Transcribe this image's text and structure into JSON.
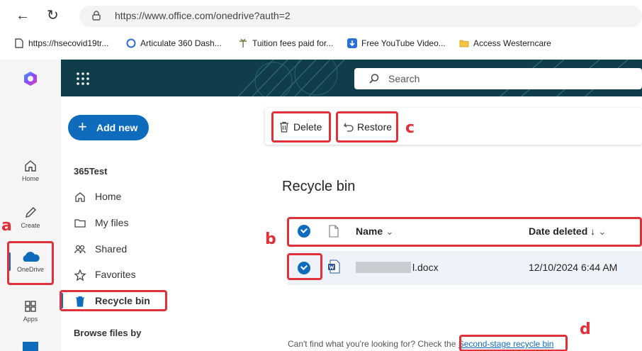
{
  "browser": {
    "url": "https://www.office.com/onedrive?auth=2",
    "bookmarks": [
      "https://hsecovid19tr...",
      "Articulate 360 Dash...",
      "Tuition fees paid for...",
      "Free YouTube Video...",
      "Access Westerncare"
    ]
  },
  "rail": {
    "home": "Home",
    "create": "Create",
    "onedrive": "OneDrive",
    "apps": "Apps"
  },
  "header": {
    "search_placeholder": "Search"
  },
  "leftnav": {
    "add_new": "Add new",
    "account": "365Test",
    "items": [
      "Home",
      "My files",
      "Shared",
      "Favorites",
      "Recycle bin"
    ],
    "browse_title": "Browse files by"
  },
  "commands": {
    "delete": "Delete",
    "restore": "Restore"
  },
  "main": {
    "title": "Recycle bin",
    "col_name": "Name",
    "col_date": "Date deleted",
    "rows": [
      {
        "name_suffix": "l.docx",
        "date": "12/10/2024 6:44 AM"
      }
    ],
    "footer_text": "Can't find what you're looking for? Check the",
    "footer_link": "Second-stage recycle bin"
  },
  "annotations": {
    "a": "a",
    "b": "b",
    "c": "c",
    "d": "d"
  },
  "colors": {
    "accent": "#0f6cbd",
    "annotation": "#e0303a",
    "header_bg": "#0f3d4a"
  }
}
